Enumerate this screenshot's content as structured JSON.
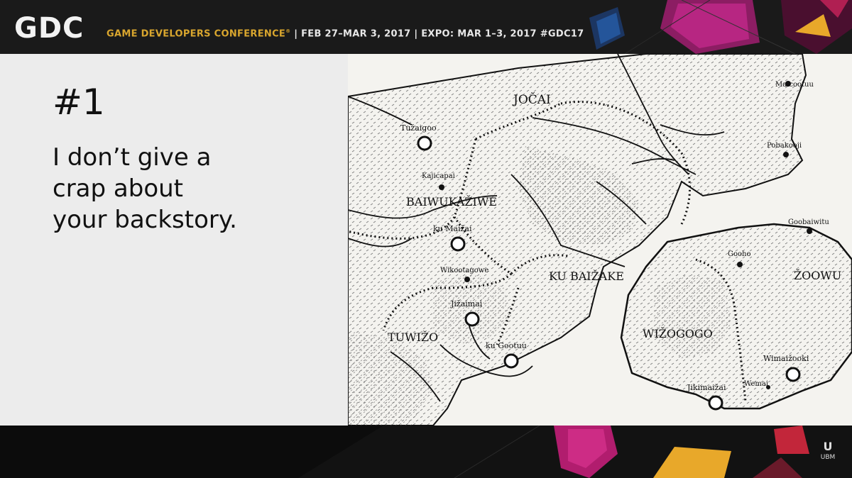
{
  "banner": {
    "logo": "GDC",
    "conference": "GAME DEVELOPERS CONFERENCE",
    "registered_mark": "®",
    "dates": " | FEB 27–MAR 3, 2017 | EXPO: MAR 1–3, 2017 #GDC17"
  },
  "slide": {
    "number": "#1",
    "lines": [
      "I don’t give a",
      "crap about",
      "your backstory."
    ]
  },
  "map": {
    "regions": [
      "JOČAI",
      "BAIWUKAŽIWE",
      "KU BAIŽAKE",
      "TUWIŽO",
      "WIŽOGOGO",
      "ŽOOWU"
    ],
    "places": [
      "Tužaigoo",
      "Kajicapai",
      "ku Maižai",
      "Wikootagowe",
      "Jižaimai",
      "ku Gootuu",
      "Maicootuu",
      "Pobakooji",
      "Goobaiwitu",
      "Gooho",
      "Wimaižooki",
      "Wemai",
      "Jikimaižai"
    ]
  },
  "footer": {
    "logo": "UBM",
    "logo_mark": "U"
  },
  "colors": {
    "conference": "#d9a62e",
    "slide_bg": "#ececec",
    "map_bg": "#f4f3ef"
  }
}
